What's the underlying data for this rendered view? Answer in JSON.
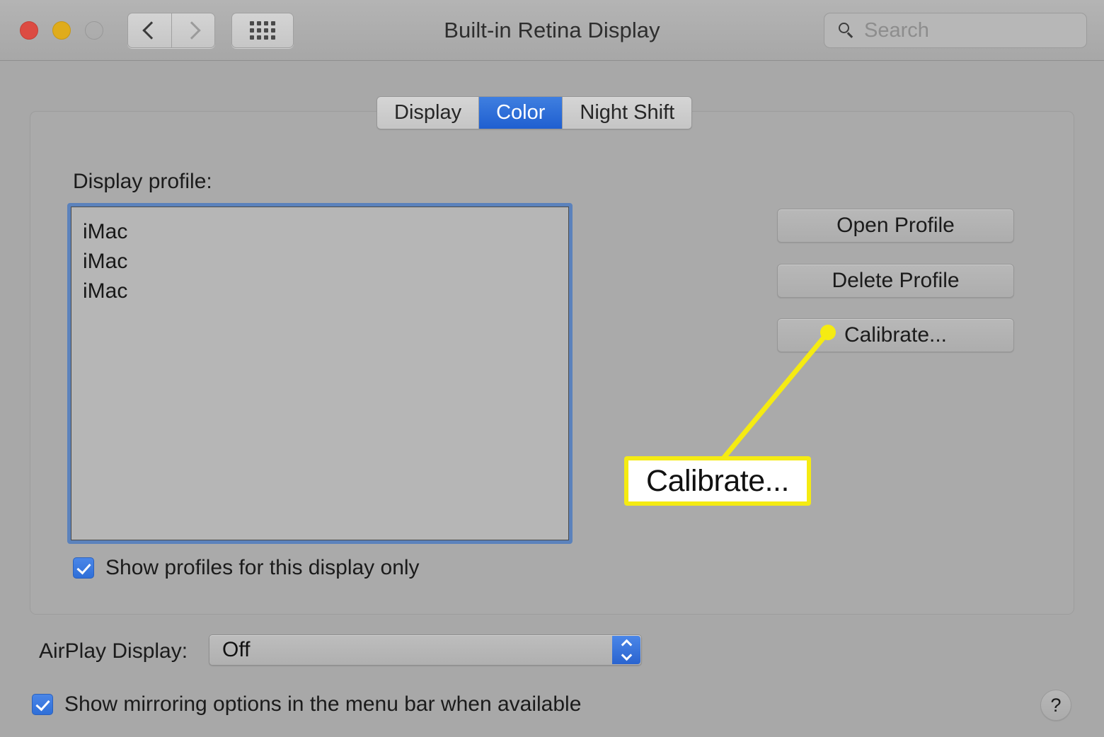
{
  "window": {
    "title": "Built-in Retina Display",
    "traffic_lights": [
      "close",
      "minimize",
      "zoom"
    ]
  },
  "toolbar": {
    "back_icon": "chevron-left-icon",
    "forward_icon": "chevron-right-icon",
    "show_all_icon": "grid-icon",
    "search": {
      "placeholder": "Search",
      "value": "Search",
      "icon": "search-icon"
    }
  },
  "tabs": [
    {
      "label": "Display",
      "active": false
    },
    {
      "label": "Color",
      "active": true
    },
    {
      "label": "Night Shift",
      "active": false
    }
  ],
  "panel": {
    "profile_label": "Display profile:",
    "profiles": [
      "iMac",
      "iMac",
      "iMac"
    ],
    "buttons": [
      {
        "label": "Open Profile"
      },
      {
        "label": "Delete Profile"
      },
      {
        "label": "Calibrate..."
      }
    ],
    "show_profiles_checkbox": {
      "label": "Show profiles for this display only",
      "checked": true
    }
  },
  "airplay": {
    "label": "AirPlay Display:",
    "value": "Off",
    "options": [
      "Off"
    ],
    "stepper_icon": "chevron-up-down-icon"
  },
  "mirroring_checkbox": {
    "label": "Show mirroring options in the menu bar when available",
    "checked": true
  },
  "help": {
    "label": "?"
  },
  "annotation": {
    "callout_text": "Calibrate...",
    "target": "Calibrate... button",
    "color": "#f5eb12",
    "box_background": "#ffffff",
    "box_text_color": "#111111"
  },
  "colors": {
    "window_background": "#a8a8a8",
    "titlebar": "#b0b0b0",
    "panel_background": "#aaaaaa",
    "accent_blue": "#2f6fd8",
    "tab_active_blue": "#2d6ed6",
    "focus_ring": "#5b82bc",
    "annotation_yellow": "#f5eb12"
  }
}
